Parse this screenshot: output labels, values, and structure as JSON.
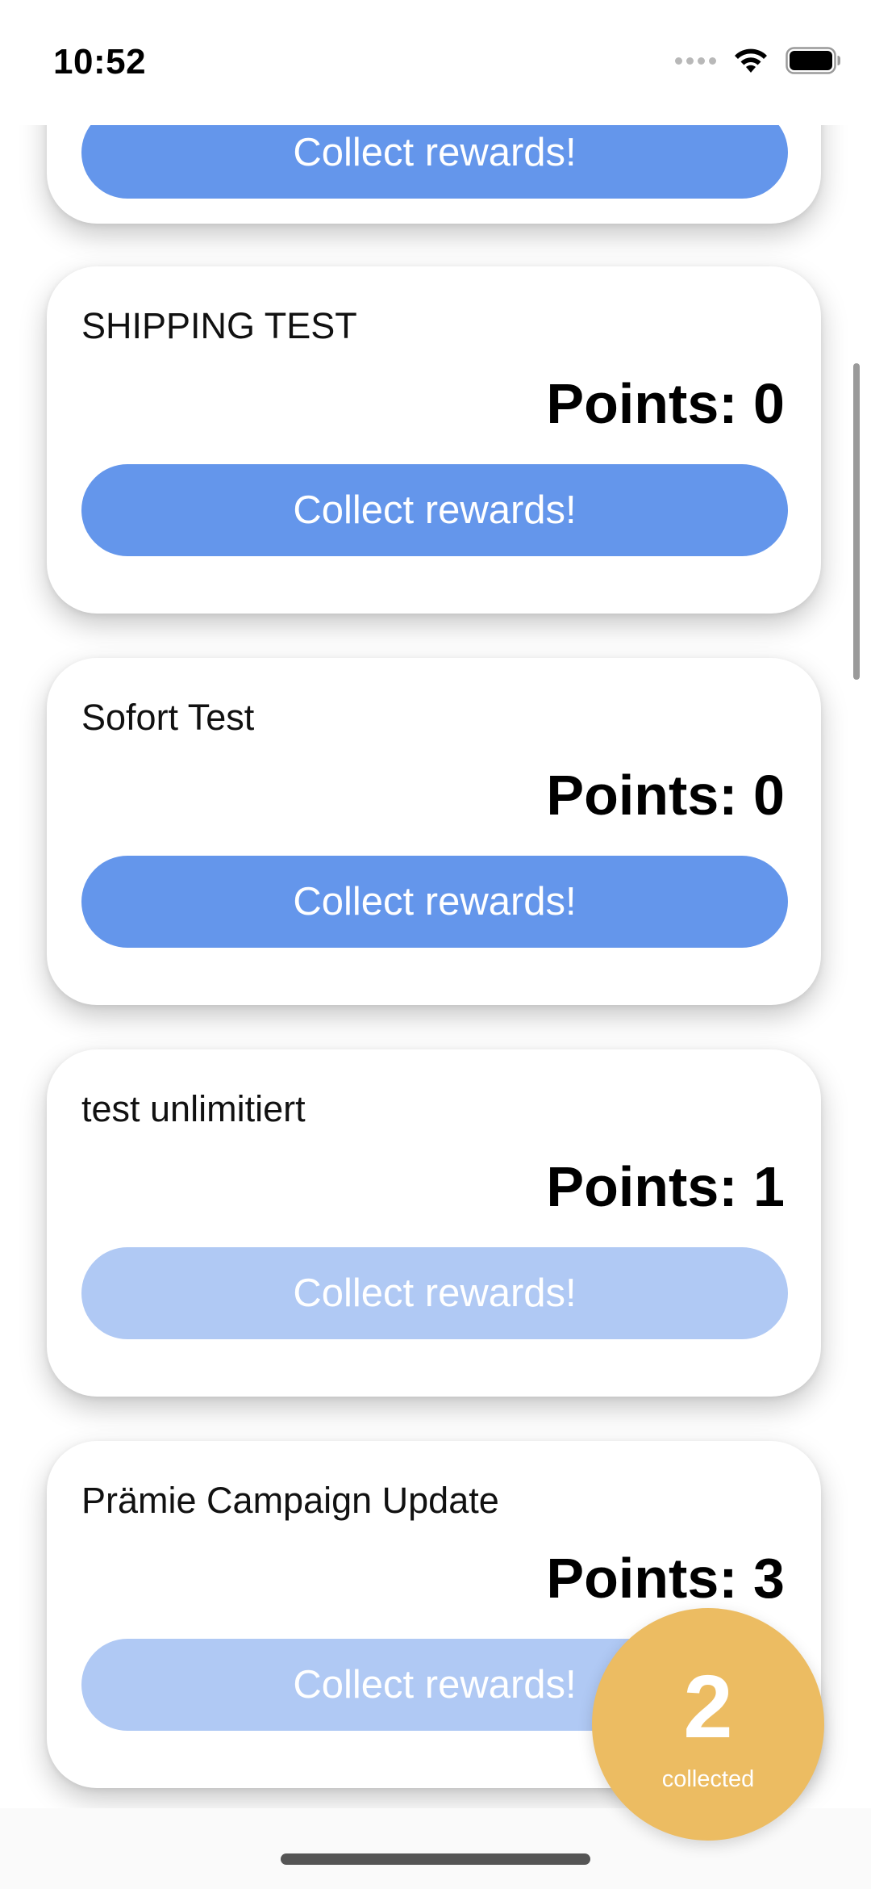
{
  "status_bar": {
    "time": "10:52",
    "icons": [
      "cellular-dots-icon",
      "wifi-icon",
      "battery-icon"
    ]
  },
  "colors": {
    "button_active": "#6496eb",
    "button_disabled": "#b0c9f4",
    "badge": "#ecbc62"
  },
  "cards": [
    {
      "title": "",
      "points": "",
      "button_label": "Collect rewards!",
      "enabled": true
    },
    {
      "title": "SHIPPING TEST",
      "points": "Points: 0",
      "button_label": "Collect rewards!",
      "enabled": true
    },
    {
      "title": "Sofort Test",
      "points": "Points: 0",
      "button_label": "Collect rewards!",
      "enabled": true
    },
    {
      "title": "test unlimitiert",
      "points": "Points: 1",
      "button_label": "Collect rewards!",
      "enabled": false
    },
    {
      "title": "Prämie Campaign Update",
      "points": "Points: 3",
      "button_label": "Collect rewards!",
      "enabled": false
    }
  ],
  "collected_badge": {
    "count": "2",
    "label": "collected"
  }
}
